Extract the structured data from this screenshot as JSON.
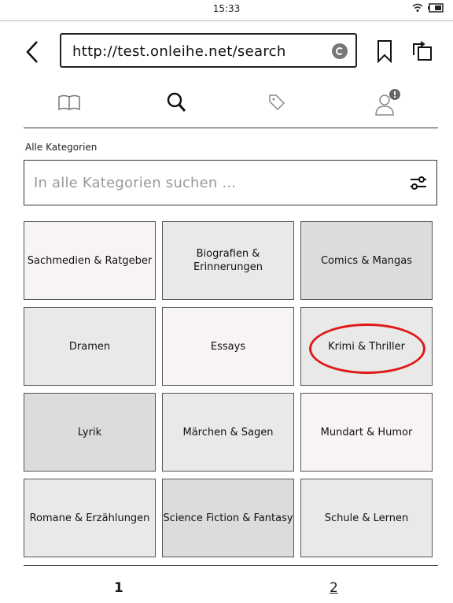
{
  "status": {
    "time": "15:33"
  },
  "browser": {
    "url": "http://test.onleihe.net/search"
  },
  "tabs": [
    {
      "name": "library",
      "icon": "book-icon"
    },
    {
      "name": "search",
      "icon": "search-icon"
    },
    {
      "name": "tags",
      "icon": "tag-icon"
    },
    {
      "name": "account",
      "icon": "user-icon",
      "badge": "!"
    }
  ],
  "search": {
    "category_label": "Alle Kategorien",
    "placeholder": "In alle Kategorien suchen ..."
  },
  "categories": [
    {
      "label": "Sachmedien & Ratgeber",
      "shade": "light"
    },
    {
      "label": "Biografien & Erinnerungen",
      "shade": "mid"
    },
    {
      "label": "Comics & Mangas",
      "shade": "dark"
    },
    {
      "label": "Dramen",
      "shade": "mid"
    },
    {
      "label": "Essays",
      "shade": "light"
    },
    {
      "label": "Krimi & Thriller",
      "shade": "mid",
      "highlighted": true
    },
    {
      "label": "Lyrik",
      "shade": "dark"
    },
    {
      "label": "Märchen & Sagen",
      "shade": "mid"
    },
    {
      "label": "Mundart & Humor",
      "shade": "light"
    },
    {
      "label": "Romane & Erzählungen",
      "shade": "mid"
    },
    {
      "label": "Science Fiction & Fantasy",
      "shade": "dark"
    },
    {
      "label": "Schule & Lernen",
      "shade": "mid"
    }
  ],
  "pagination": {
    "page1": "1",
    "page2": "2",
    "current": "1"
  },
  "colors": {
    "highlight": "#e01a1a",
    "cell_light": "#f7f3f6",
    "cell_mid": "#e9e9e9",
    "cell_dark": "#dcdbdd"
  }
}
